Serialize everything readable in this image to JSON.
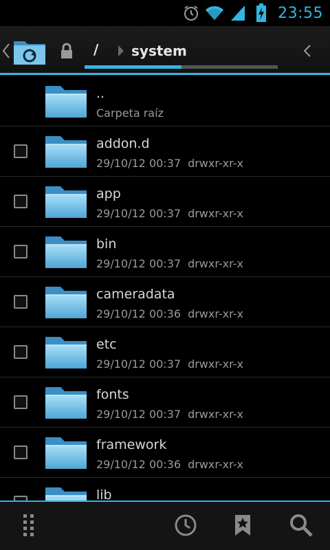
{
  "status_bar": {
    "time": "23:55",
    "icons": [
      "alarm-icon",
      "wifi-icon",
      "signal-icon",
      "battery-charging-icon"
    ]
  },
  "navigation": {
    "home_icon": "folder-refresh-icon",
    "lock_icon": "lock-icon",
    "root_label": "/",
    "current_label": "system",
    "progress_fraction": 0.5
  },
  "files": [
    {
      "name": "..",
      "subtitle": "Carpeta raíz",
      "checkbox": false
    },
    {
      "name": "addon.d",
      "date": "29/10/12 00:37",
      "perms": "drwxr-xr-x",
      "checkbox": true
    },
    {
      "name": "app",
      "date": "29/10/12 00:37",
      "perms": "drwxr-xr-x",
      "checkbox": true
    },
    {
      "name": "bin",
      "date": "29/10/12 00:37",
      "perms": "drwxr-xr-x",
      "checkbox": true
    },
    {
      "name": "cameradata",
      "date": "29/10/12 00:36",
      "perms": "drwxr-xr-x",
      "checkbox": true
    },
    {
      "name": "etc",
      "date": "29/10/12 00:37",
      "perms": "drwxr-xr-x",
      "checkbox": true
    },
    {
      "name": "fonts",
      "date": "29/10/12 00:37",
      "perms": "drwxr-xr-x",
      "checkbox": true
    },
    {
      "name": "framework",
      "date": "29/10/12 00:36",
      "perms": "drwxr-xr-x",
      "checkbox": true
    },
    {
      "name": "lib",
      "date": "",
      "perms": "",
      "checkbox": true
    }
  ],
  "bottom_bar": {
    "buttons": [
      "menu-grid-icon",
      "history-clock-icon",
      "bookmark-icon",
      "search-icon"
    ]
  },
  "colors": {
    "accent": "#33b5e5",
    "background": "#000000",
    "folder_light": "#8fd3f4",
    "folder_dark": "#3a8fc4"
  }
}
